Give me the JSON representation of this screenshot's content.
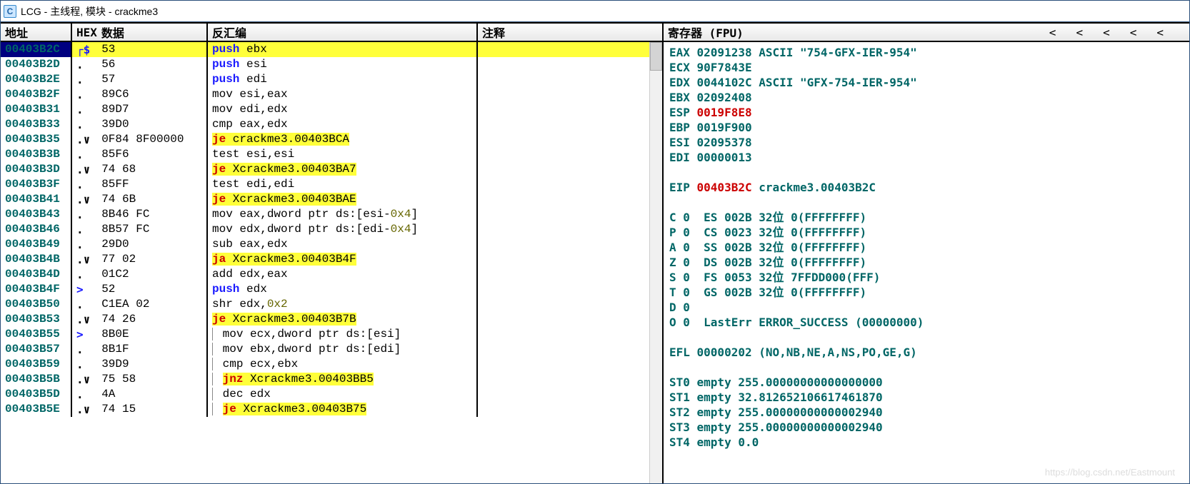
{
  "window": {
    "title": "LCG -  主线程, 模块 - crackme3",
    "icon_letter": "C"
  },
  "columns": {
    "addr": "地址",
    "hex_pre": "HEX",
    "hex": "数据",
    "disasm": "反汇编",
    "comment": "注释"
  },
  "reg_header": {
    "title": "寄存器 (FPU)",
    "chev": "<"
  },
  "disasm": [
    {
      "addr": "00403B2C",
      "prefix": "┌$",
      "hex": "53",
      "mnem": "push",
      "args": "ebx",
      "hl": true,
      "sel": true
    },
    {
      "addr": "00403B2D",
      "prefix": ".",
      "hex": "56",
      "mnem": "push",
      "args": "esi"
    },
    {
      "addr": "00403B2E",
      "prefix": ".",
      "hex": "57",
      "mnem": "push",
      "args": "edi"
    },
    {
      "addr": "00403B2F",
      "prefix": ".",
      "hex": "89C6",
      "mnem": "mov",
      "args": "esi,eax",
      "style": "norm"
    },
    {
      "addr": "00403B31",
      "prefix": ".",
      "hex": "89D7",
      "mnem": "mov",
      "args": "edi,edx",
      "style": "norm"
    },
    {
      "addr": "00403B33",
      "prefix": ".",
      "hex": "39D0",
      "mnem": "cmp",
      "args": "eax,edx",
      "style": "norm"
    },
    {
      "addr": "00403B35",
      "prefix": ".∨",
      "hex": "0F84 8F00000",
      "mnem": "je",
      "args": "crackme3.00403BCA",
      "jmp": true,
      "hlTarget": true
    },
    {
      "addr": "00403B3B",
      "prefix": ".",
      "hex": "85F6",
      "mnem": "test",
      "args": "esi,esi",
      "style": "norm"
    },
    {
      "addr": "00403B3D",
      "prefix": ".∨",
      "hex": "74 68",
      "mnem": "je",
      "args": "Xcrackme3.00403BA7",
      "jmp": true,
      "hlTarget": true
    },
    {
      "addr": "00403B3F",
      "prefix": ".",
      "hex": "85FF",
      "mnem": "test",
      "args": "edi,edi",
      "style": "norm"
    },
    {
      "addr": "00403B41",
      "prefix": ".∨",
      "hex": "74 6B",
      "mnem": "je",
      "args": "Xcrackme3.00403BAE",
      "jmp": true,
      "hlTarget": true
    },
    {
      "addr": "00403B43",
      "prefix": ".",
      "hex": "8B46 FC",
      "mnem": "mov",
      "args": "eax,dword ptr ds:[esi-0x4]",
      "style": "norm",
      "numpart": "0x4"
    },
    {
      "addr": "00403B46",
      "prefix": ".",
      "hex": "8B57 FC",
      "mnem": "mov",
      "args": "edx,dword ptr ds:[edi-0x4]",
      "style": "norm",
      "numpart": "0x4"
    },
    {
      "addr": "00403B49",
      "prefix": ".",
      "hex": "29D0",
      "mnem": "sub",
      "args": "eax,edx",
      "style": "norm"
    },
    {
      "addr": "00403B4B",
      "prefix": ".∨",
      "hex": "77 02",
      "mnem": "ja",
      "args": "Xcrackme3.00403B4F",
      "jmp": true,
      "hlTarget": true
    },
    {
      "addr": "00403B4D",
      "prefix": ".",
      "hex": "01C2",
      "mnem": "add",
      "args": "edx,eax",
      "style": "norm"
    },
    {
      "addr": "00403B4F",
      "prefix": ">",
      "hex": "52",
      "mnem": "push",
      "args": "edx"
    },
    {
      "addr": "00403B50",
      "prefix": ".",
      "hex": "C1EA 02",
      "mnem": "shr",
      "args": "edx,0x2",
      "style": "norm",
      "numpart": "0x2"
    },
    {
      "addr": "00403B53",
      "prefix": ".∨",
      "hex": "74 26",
      "mnem": "je",
      "args": "Xcrackme3.00403B7B",
      "jmp": true,
      "hlTarget": true
    },
    {
      "addr": "00403B55",
      "prefix": ">",
      "hex": "8B0E",
      "mnem": "mov",
      "args": "ecx,dword ptr ds:[esi]",
      "style": "norm",
      "guide": true
    },
    {
      "addr": "00403B57",
      "prefix": ".",
      "hex": "8B1F",
      "mnem": "mov",
      "args": "ebx,dword ptr ds:[edi]",
      "style": "norm",
      "guide": true
    },
    {
      "addr": "00403B59",
      "prefix": ".",
      "hex": "39D9",
      "mnem": "cmp",
      "args": "ecx,ebx",
      "style": "norm",
      "guide": true
    },
    {
      "addr": "00403B5B",
      "prefix": ".∨",
      "hex": "75 58",
      "mnem": "jnz",
      "args": "Xcrackme3.00403BB5",
      "jmp": true,
      "hlTarget": true,
      "guide": true
    },
    {
      "addr": "00403B5D",
      "prefix": ".",
      "hex": "4A",
      "mnem": "dec",
      "args": "edx",
      "style": "norm",
      "guide": true
    },
    {
      "addr": "00403B5E",
      "prefix": ".∨",
      "hex": "74 15",
      "mnem": "je",
      "args": "Xcrackme3.00403B75",
      "jmp": true,
      "hlTarget": true,
      "guide": true
    }
  ],
  "registers": {
    "gp": [
      {
        "name": "EAX",
        "val": "02091238",
        "extra": " ASCII \"754-GFX-IER-954\""
      },
      {
        "name": "ECX",
        "val": "90F7843E",
        "extra": ""
      },
      {
        "name": "EDX",
        "val": "0044102C",
        "extra": " ASCII \"GFX-754-IER-954\""
      },
      {
        "name": "EBX",
        "val": "02092408",
        "extra": ""
      },
      {
        "name": "ESP",
        "val": "0019F8E8",
        "extra": "",
        "red": true
      },
      {
        "name": "EBP",
        "val": "0019F900",
        "extra": ""
      },
      {
        "name": "ESI",
        "val": "02095378",
        "extra": ""
      },
      {
        "name": "EDI",
        "val": "00000013",
        "extra": ""
      }
    ],
    "eip": {
      "name": "EIP",
      "val": "00403B2C",
      "extra": " crackme3.00403B2C"
    },
    "flags": [
      "C 0  ES 002B 32位 0(FFFFFFFF)",
      "P 0  CS 0023 32位 0(FFFFFFFF)",
      "A 0  SS 002B 32位 0(FFFFFFFF)",
      "Z 0  DS 002B 32位 0(FFFFFFFF)",
      "S 0  FS 0053 32位 7FFDD000(FFF)",
      "T 0  GS 002B 32位 0(FFFFFFFF)",
      "D 0",
      "O 0  LastErr ERROR_SUCCESS (00000000)"
    ],
    "efl": "EFL 00000202 (NO,NB,NE,A,NS,PO,GE,G)",
    "fpu": [
      "ST0 empty 255.00000000000000000",
      "ST1 empty 32.812652106617461870",
      "ST2 empty 255.00000000000002940",
      "ST3 empty 255.00000000000002940",
      "ST4 empty 0.0"
    ]
  },
  "watermark": "https://blog.csdn.net/Eastmount"
}
